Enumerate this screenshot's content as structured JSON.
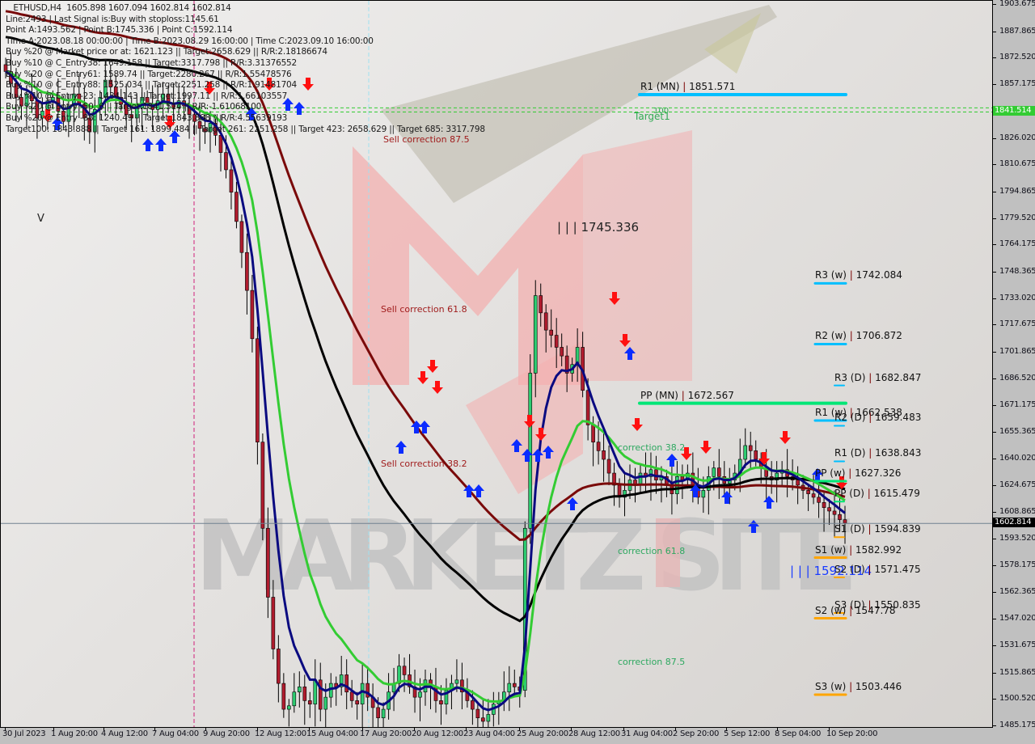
{
  "header": {
    "symbol": "ETHUSD,H4",
    "ohlc": "1605.898 1607.094 1602.814 1602.814",
    "lines": [
      "Line:2493 | Last Signal is:Buy with stoploss:1145.61",
      "Point A:1493.562 | Point B:1745.336 | Point C:1592.114",
      "Time A:2023.08.18 00:00:00 | Time B:2023.08.29 16:00:00 | Time C:2023.09.10 16:00:00",
      "Buy %20 @ Market price or at: 1621.123 || Target:2658.629 || R/R:2.18186674",
      "Buy %10 @ C_Entry38: 1649.158 || Target:3317.798 || R/R:3.31376552",
      "Buy %20 @ C_Entry61: 1589.74 || Target:2280.267 || R/R:1.55478576",
      "Buy %10 @ C_Entry88: 1525.034 || Target:2251.258 || R/R:1.91481704",
      "Buy %10 @ Entry -23: 1434.143 || Target:1997.11 || R/R:1.66103557",
      "Buy %20 @ Entry -50: 6 || Target:1841.514 || R/R:-1.61068100",
      "Buy %20 @ Entry -88: 1240.49 || Target:1843.888 || R/R:4.55639193",
      "Target100: 1843.888 || Target 161: 1899.484 || Target 261: 2251.258 || Target 423: 2658.629 || Target 685: 3317.798"
    ]
  },
  "colors": {
    "bull_candle": "#2ecc71",
    "bear_candle": "#b01c2e",
    "ma_fast": "#0a0a80",
    "ma_mid": "#33cc33",
    "ma_slow": "#000000",
    "ma_slowest": "#7a0a0a",
    "resistance": "#00bfff",
    "pivot": "#00e676",
    "support": "#ffa500",
    "sell_arrow": "#ff1010",
    "buy_arrow": "#0b2cff",
    "target_line": "#33cc33",
    "sell_corr_text": "#a01c1c",
    "buy_corr_text": "#2ea860",
    "current_price_bg": "#000000",
    "target_tag_bg": "#33cc33"
  },
  "chart_data": {
    "type": "candlestick",
    "title": "ETHUSD,H4",
    "ylim": [
      1485.175,
      1903.675
    ],
    "y_ticks": [
      "1903.675",
      "1887.865",
      "1872.520",
      "1857.175",
      "1841.514",
      "1826.020",
      "1810.675",
      "1794.865",
      "1779.520",
      "1764.175",
      "1748.365",
      "1733.020",
      "1717.675",
      "1701.865",
      "1686.520",
      "1671.175",
      "1655.365",
      "1640.020",
      "1624.675",
      "1608.865",
      "1593.520",
      "1578.175",
      "1562.365",
      "1547.020",
      "1531.675",
      "1515.865",
      "1500.520",
      "1485.175"
    ],
    "y_tick_values": [
      1903.675,
      1887.865,
      1872.52,
      1857.175,
      1841.514,
      1826.02,
      1810.675,
      1794.865,
      1779.52,
      1764.175,
      1748.365,
      1733.02,
      1717.675,
      1701.865,
      1686.52,
      1671.175,
      1655.365,
      1640.02,
      1624.675,
      1608.865,
      1593.52,
      1578.175,
      1562.365,
      1547.02,
      1531.675,
      1515.865,
      1500.52,
      1485.175
    ],
    "x_ticks": [
      "30 Jul 2023",
      "1 Aug 20:00",
      "4 Aug 12:00",
      "7 Aug 04:00",
      "9 Aug 20:00",
      "12 Aug 12:00",
      "15 Aug 04:00",
      "17 Aug 20:00",
      "20 Aug 12:00",
      "23 Aug 04:00",
      "25 Aug 20:00",
      "28 Aug 12:00",
      "31 Aug 04:00",
      "2 Sep 20:00",
      "5 Sep 12:00",
      "8 Sep 04:00",
      "10 Sep 20:00"
    ],
    "current_price": "1602.814",
    "target_tag": "1841.514",
    "target_tag_hidden": "1843.888",
    "close_series": [
      1865,
      1858,
      1850,
      1845,
      1852,
      1848,
      1838,
      1842,
      1848,
      1850,
      1842,
      1836,
      1845,
      1852,
      1846,
      1838,
      1830,
      1843,
      1850,
      1860,
      1856,
      1850,
      1846,
      1840,
      1838,
      1844,
      1850,
      1846,
      1843,
      1848,
      1852,
      1846,
      1844,
      1848,
      1845,
      1840,
      1836,
      1832,
      1830,
      1835,
      1828,
      1818,
      1808,
      1795,
      1778,
      1760,
      1738,
      1710,
      1650,
      1600,
      1560,
      1530,
      1510,
      1495,
      1497,
      1505,
      1508,
      1500,
      1498,
      1512,
      1495,
      1502,
      1510,
      1508,
      1515,
      1505,
      1500,
      1498,
      1510,
      1502,
      1496,
      1490,
      1495,
      1505,
      1510,
      1520,
      1515,
      1508,
      1502,
      1505,
      1512,
      1508,
      1500,
      1498,
      1506,
      1510,
      1512,
      1505,
      1500,
      1495,
      1490,
      1488,
      1492,
      1498,
      1500,
      1505,
      1510,
      1508,
      1506,
      1600,
      1690,
      1735,
      1725,
      1715,
      1712,
      1705,
      1700,
      1690,
      1695,
      1705,
      1680,
      1660,
      1650,
      1645,
      1640,
      1632,
      1625,
      1618,
      1622,
      1628,
      1625,
      1632,
      1630,
      1634,
      1628,
      1630,
      1625,
      1620,
      1630,
      1628,
      1632,
      1625,
      1618,
      1622,
      1630,
      1635,
      1630,
      1626,
      1628,
      1632,
      1640,
      1648,
      1645,
      1640,
      1635,
      1630,
      1628,
      1632,
      1634,
      1630,
      1628,
      1625,
      1622,
      1620,
      1618,
      1615,
      1612,
      1610,
      1608,
      1605,
      1603
    ],
    "series": [
      {
        "name": "MA fast (navy)",
        "values": []
      },
      {
        "name": "MA mid (green)",
        "values": []
      },
      {
        "name": "MA slow (black)",
        "values": []
      },
      {
        "name": "MA slowest (dark red)",
        "values": []
      }
    ],
    "pivot_levels": [
      {
        "label": "R1 (MN)",
        "value": "1851.571",
        "kind": "resistance"
      },
      {
        "label": "PP (MN)",
        "value": "1672.567",
        "kind": "pivot"
      },
      {
        "label": "R3 (w)",
        "value": "1742.084",
        "kind": "resistance"
      },
      {
        "label": "R2 (w)",
        "value": "1706.872",
        "kind": "resistance"
      },
      {
        "label": "R1 (w)",
        "value": "1662.538",
        "kind": "resistance"
      },
      {
        "label": "PP (w)",
        "value": "1627.326",
        "kind": "pivot"
      },
      {
        "label": "S1 (w)",
        "value": "1582.992",
        "kind": "support"
      },
      {
        "label": "S2 (w)",
        "value": "1547.78",
        "kind": "support"
      },
      {
        "label": "S3 (w)",
        "value": "1503.446",
        "kind": "support"
      },
      {
        "label": "R3 (D)",
        "value": "1682.847",
        "kind": "resistance"
      },
      {
        "label": "R2 (D)",
        "value": "1659.483",
        "kind": "resistance"
      },
      {
        "label": "R1 (D)",
        "value": "1638.843",
        "kind": "resistance"
      },
      {
        "label": "PP (D)",
        "value": "1615.479",
        "kind": "pivot"
      },
      {
        "label": "S1 (D)",
        "value": "1594.839",
        "kind": "support"
      },
      {
        "label": "S2 (D)",
        "value": "1571.475",
        "kind": "support"
      },
      {
        "label": "S3 (D)",
        "value": "1550.835",
        "kind": "support"
      }
    ],
    "annotations": {
      "point_b_label": "| | | 1745.336",
      "point_c_label": "| | | 1592.114",
      "point_a_marker": "V",
      "target_label": "Target1",
      "target_pct": "100",
      "sell_corrections": [
        "Sell correction 87.5",
        "Sell correction 61.8",
        "Sell correction 38.2"
      ],
      "buy_corrections": [
        "correction 38.2",
        "correction 61.8",
        "correction 87.5"
      ]
    },
    "watermark": "MARKETZ SITE"
  }
}
